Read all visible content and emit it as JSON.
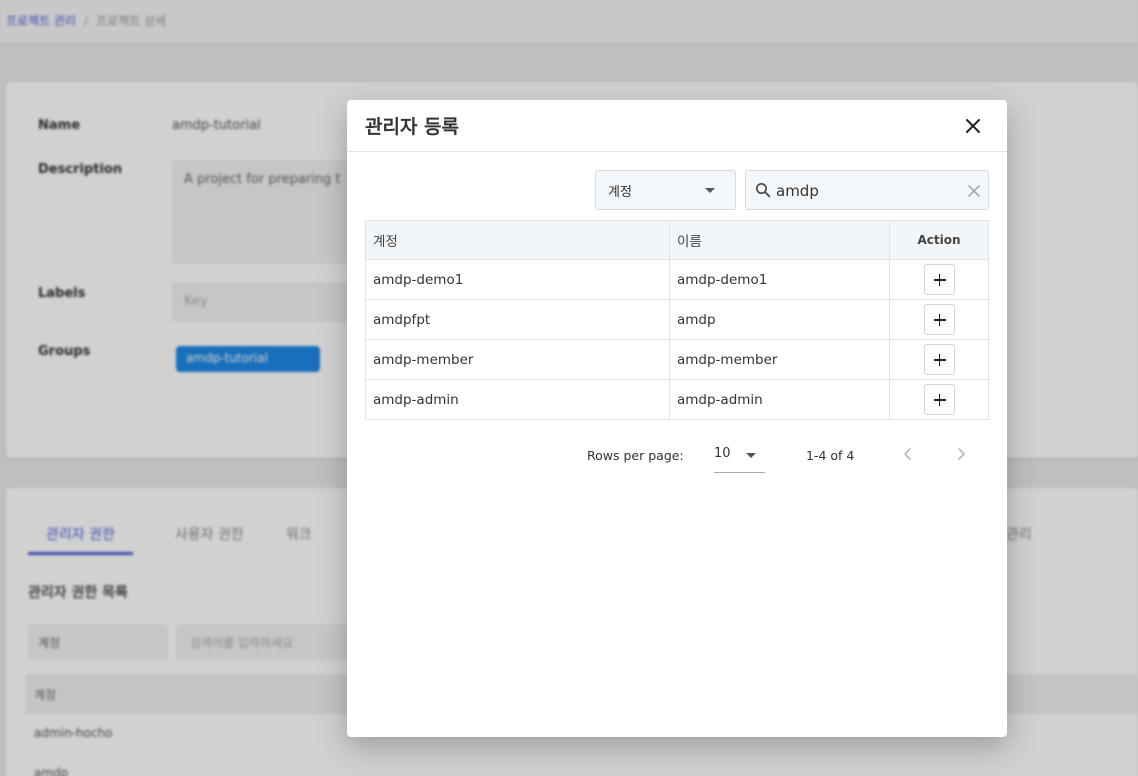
{
  "background": {
    "breadcrumb": {
      "parent": "프로젝트 관리",
      "current": "프로젝트 상세"
    },
    "fields": {
      "name_label": "Name",
      "name_value": "amdp-tutorial",
      "description_label": "Description",
      "description_value": "A project for preparing t",
      "labels_label": "Labels",
      "labels_placeholder": "Key",
      "groups_label": "Groups",
      "group_chip": "amdp-tutorial"
    },
    "tabs": [
      "관리자 권한",
      "사용자 권한",
      "워크",
      "관리"
    ],
    "section_title": "관리자 권한 목록",
    "filter_value": "계정",
    "search_placeholder": "검색어를 입력하세요",
    "table_header": "계정",
    "rows": [
      "admin-hocho",
      "amdp"
    ]
  },
  "dialog": {
    "title": "관리자 등록",
    "filter": {
      "selected": "계정"
    },
    "search": {
      "value": "amdp"
    },
    "table": {
      "columns": [
        "계정",
        "이름",
        "Action"
      ],
      "rows": [
        {
          "account": "amdp-demo1",
          "name": "amdp-demo1"
        },
        {
          "account": "amdpfpt",
          "name": "amdp"
        },
        {
          "account": "amdp-member",
          "name": "amdp-member"
        },
        {
          "account": "amdp-admin",
          "name": "amdp-admin"
        }
      ]
    },
    "pagination": {
      "rows_per_page_label": "Rows per page:",
      "rows_per_page": "10",
      "range": "1-4 of 4"
    }
  }
}
